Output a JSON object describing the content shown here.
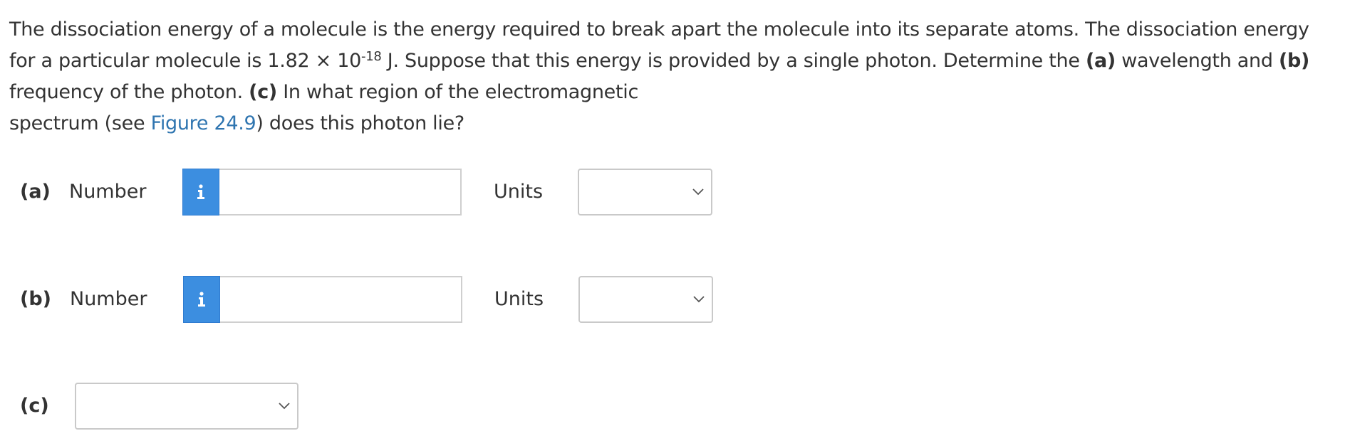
{
  "question": {
    "t1": "The dissociation energy of a molecule is the energy required to break apart the molecule into its separate atoms. The dissociation energy for a particular molecule is 1.82 × 10",
    "exp": "-18",
    "t2": " J. Suppose that this energy is provided by a single photon. Determine the ",
    "a": "(a)",
    "t3": " wavelength and ",
    "b": "(b)",
    "t4": " frequency of the photon. ",
    "c": "(c)",
    "t5": " In what region of the electromagnetic",
    "t6": "spectrum (see ",
    "link": "Figure 24.9",
    "t7": ") does this photon lie?"
  },
  "parts": {
    "a": {
      "label": "(a)",
      "number_label": "Number",
      "value": "",
      "units_label": "Units",
      "units_selected": ""
    },
    "b": {
      "label": "(b)",
      "number_label": "Number",
      "value": "",
      "units_label": "Units",
      "units_selected": ""
    },
    "c": {
      "label": "(c)",
      "selected": ""
    }
  },
  "icons": {
    "info": "info-icon",
    "dropdown": "chevron-down-icon"
  },
  "colors": {
    "info_button": "#3c8ee0",
    "link": "#2f75b0",
    "text": "#333333"
  }
}
